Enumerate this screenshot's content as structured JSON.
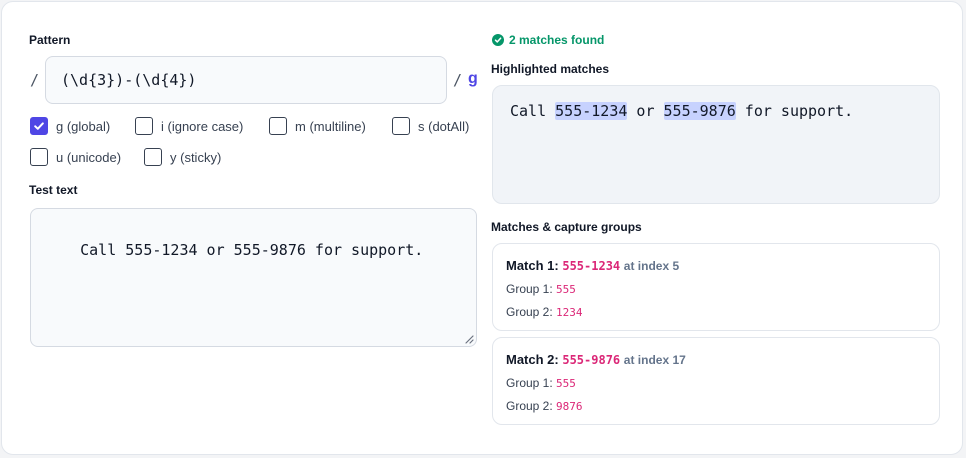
{
  "pattern": {
    "label": "Pattern",
    "open_slash": "/",
    "value": "(\\d{3})-(\\d{4})",
    "close_slash": "/",
    "active_flags": "g"
  },
  "flags": [
    {
      "label": "g (global)",
      "checked": true
    },
    {
      "label": "i (ignore case)",
      "checked": false
    },
    {
      "label": "m (multiline)",
      "checked": false
    },
    {
      "label": "s (dotAll)",
      "checked": false
    },
    {
      "label": "u (unicode)",
      "checked": false
    },
    {
      "label": "y (sticky)",
      "checked": false
    }
  ],
  "test_text": {
    "label": "Test text",
    "value": "Call 555-1234 or 555-9876 for support."
  },
  "status": {
    "text": "2 matches found",
    "icon": "check-circle-icon",
    "color": "#059669"
  },
  "highlighted": {
    "label": "Highlighted matches",
    "parts": [
      "Call ",
      "555-1234",
      " or ",
      "555-9876",
      " for support."
    ]
  },
  "matches": {
    "label": "Matches & capture groups",
    "items": [
      {
        "title": "Match 1:",
        "value": "555-1234",
        "index_text": "at index 5",
        "groups": [
          {
            "label": "Group 1:",
            "value": "555"
          },
          {
            "label": "Group 2:",
            "value": "1234"
          }
        ]
      },
      {
        "title": "Match 2:",
        "value": "555-9876",
        "index_text": "at index 17",
        "groups": [
          {
            "label": "Group 1:",
            "value": "555"
          },
          {
            "label": "Group 2:",
            "value": "9876"
          }
        ]
      }
    ]
  },
  "colors": {
    "accent": "#4f46e5",
    "success": "#059669",
    "match_value": "#db2777",
    "highlight": "#c7d2fe"
  }
}
